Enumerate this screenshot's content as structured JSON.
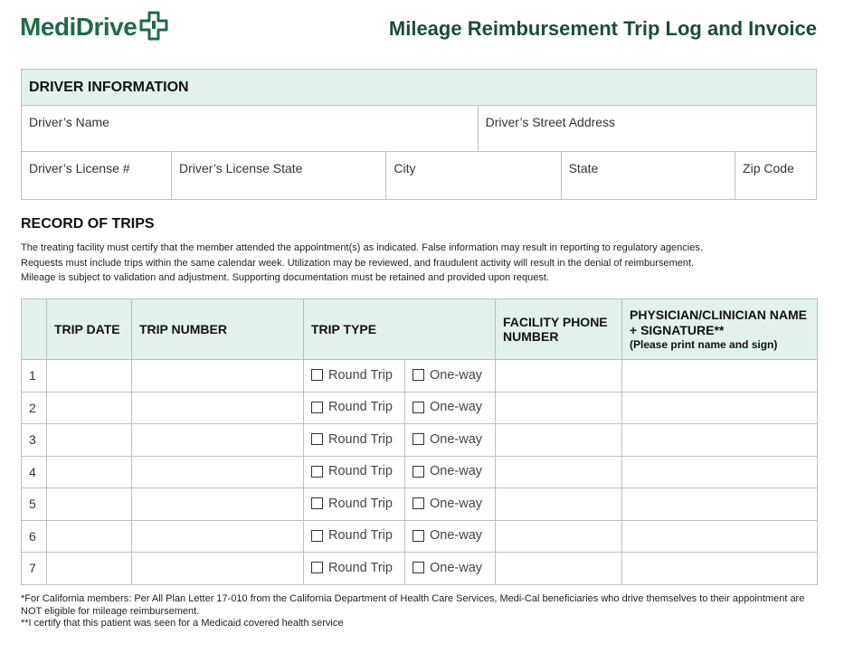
{
  "brand": {
    "name": "MediDrive",
    "color": "#1e6b47"
  },
  "document": {
    "title": "Mileage Reimbursement Trip Log and Invoice"
  },
  "driver_info": {
    "header": "DRIVER INFORMATION",
    "fields": {
      "name": "Driver’s Name",
      "street_address": "Driver’s Street Address",
      "license_number": "Driver’s License #",
      "license_state": "Driver’s License State",
      "city": "City",
      "state": "State",
      "zip": "Zip Code"
    }
  },
  "record_of_trips": {
    "title": "RECORD OF TRIPS",
    "notice_lines": [
      "The treating facility must certify that the member attended the appointment(s) as indicated. False information may result in reporting to regulatory agencies.",
      "Requests must include trips within the same calendar week. Utilization may be reviewed, and fraudulent activity will result in the denial of reimbursement.",
      "Mileage is subject to validation and adjustment. Supporting documentation must be retained and provided upon request."
    ],
    "columns": {
      "trip_date": "TRIP DATE",
      "trip_number": "TRIP NUMBER",
      "trip_type": "TRIP TYPE",
      "facility_phone": "FACILITY PHONE NUMBER",
      "physician": "PHYSICIAN/CLINICIAN NAME + SIGNATURE**",
      "physician_note": "(Please print name and sign)"
    },
    "option_round_trip": "Round Trip",
    "option_one_way": "One-way",
    "rows": [
      "1",
      "2",
      "3",
      "4",
      "5",
      "6",
      "7"
    ]
  },
  "footnotes": [
    "*For California members: Per All Plan Letter 17-010 from the California Department of Health Care Services, Medi-Cal beneficiaries who drive themselves to their appointment are NOT eligible for mileage reimbursement.",
    "**I certify that this patient was seen for a Medicaid covered health service"
  ]
}
